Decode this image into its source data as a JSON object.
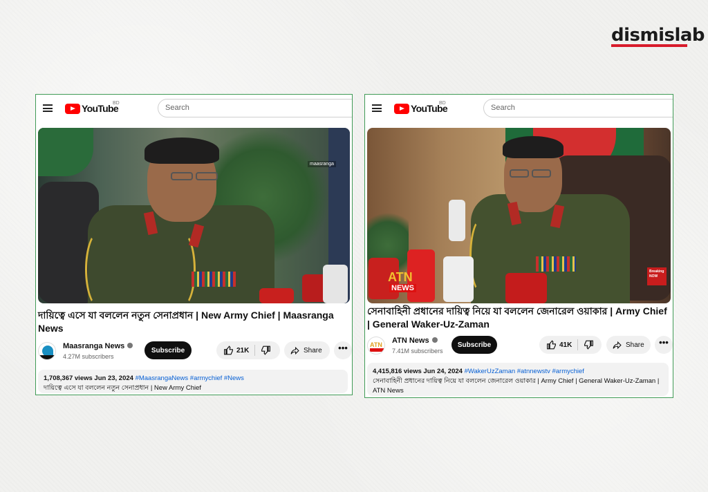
{
  "brand": {
    "name": "dismislab",
    "accent": "#d81b2b"
  },
  "cards": [
    {
      "header": {
        "logo_text": "YouTube",
        "country": "BD",
        "search_placeholder": "Search"
      },
      "video": {
        "watermark": "maasranga"
      },
      "title": "দায়িত্বে এসে যা বললেন নতুন সেনাপ্রধান | New Army Chief | Maasranga News",
      "channel": {
        "name": "Maasranga News",
        "subscribers": "4.27M subscribers",
        "subscribe_label": "Subscribe"
      },
      "actions": {
        "likes": "21K",
        "share_label": "Share",
        "more": "•••"
      },
      "description": {
        "meta": "1,708,367 views  Jun 23, 2024",
        "tags": "#MaasrangaNews #armychief #News",
        "text": "দায়িত্বে এসে যা বললেন নতুন সেনাপ্রধান | New Army Chief"
      }
    },
    {
      "header": {
        "logo_text": "YouTube",
        "country": "BD",
        "search_placeholder": "Search"
      },
      "video": {
        "badge_top": "ATN",
        "badge_bottom": "NEWS",
        "corner": "Breaking NOW"
      },
      "title": "সেনাবাহিনী প্রধানের দায়িত্ব নিয়ে যা বললেন জেনারেল ওয়াকার | Army Chief | General Waker-Uz-Zaman",
      "channel": {
        "name": "ATN News",
        "subscribers": "7.41M subscribers",
        "subscribe_label": "Subscribe"
      },
      "actions": {
        "likes": "41K",
        "share_label": "Share",
        "more": "•••"
      },
      "description": {
        "meta": "4,415,816 views  Jun 24, 2024",
        "tags": "#WakerUzZaman #atnnewstv #armychief",
        "text": "সেনাবাহিনী প্রধানের দায়িত্ব নিয়ে যা বললেন জেনারেল ওয়াকার | Army Chief | General Waker-Uz-Zaman | ATN News"
      }
    }
  ]
}
